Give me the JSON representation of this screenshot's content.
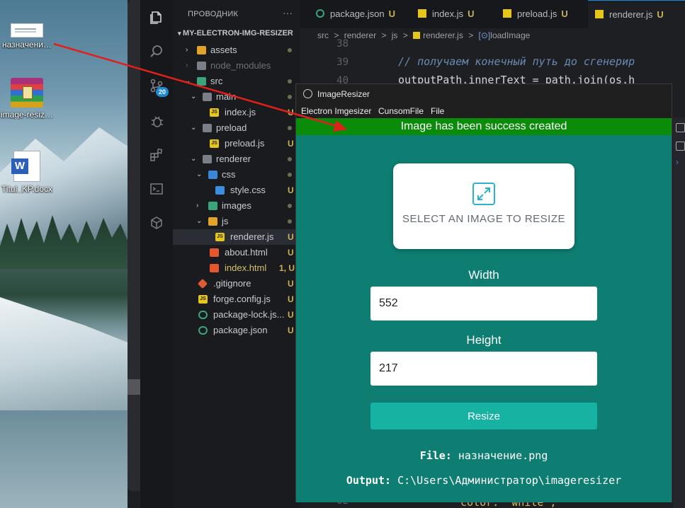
{
  "desktop": {
    "icons": [
      {
        "label": "назначени…"
      },
      {
        "label": "image-resiz…"
      },
      {
        "label": "Titul_KP.docx",
        "glyph": "W"
      }
    ]
  },
  "vscode": {
    "activity_badge": "20",
    "explorer": {
      "title": "ПРОВОДНИК",
      "more": "···",
      "root": "MY-ELECTRON-IMG-RESIZER",
      "items": [
        {
          "name": "assets",
          "status": ""
        },
        {
          "name": "node_modules",
          "status": ""
        },
        {
          "name": "src",
          "status": ""
        },
        {
          "name": "main",
          "status": ""
        },
        {
          "name": "index.js",
          "status": "U"
        },
        {
          "name": "preload",
          "status": ""
        },
        {
          "name": "preload.js",
          "status": "U"
        },
        {
          "name": "renderer",
          "status": ""
        },
        {
          "name": "css",
          "status": ""
        },
        {
          "name": "style.css",
          "status": "U"
        },
        {
          "name": "images",
          "status": ""
        },
        {
          "name": "js",
          "status": ""
        },
        {
          "name": "renderer.js",
          "status": "U"
        },
        {
          "name": "about.html",
          "status": "U"
        },
        {
          "name": "index.html",
          "status": "1, U"
        },
        {
          "name": ".gitignore",
          "status": "U"
        },
        {
          "name": "forge.config.js",
          "status": "U"
        },
        {
          "name": "package-lock.js...",
          "status": "U"
        },
        {
          "name": "package.json",
          "status": "U"
        }
      ]
    },
    "tabs": [
      {
        "label": "package.json",
        "status": "U"
      },
      {
        "label": "index.js",
        "status": "U"
      },
      {
        "label": "preload.js",
        "status": "U"
      },
      {
        "label": "renderer.js",
        "status": "U"
      }
    ],
    "breadcrumb": {
      "parts": [
        "src",
        "renderer",
        "js",
        "renderer.js",
        "loadImage"
      ],
      "sep": ">"
    },
    "code": {
      "line_numbers": [
        "38",
        "39",
        "40",
        "62"
      ],
      "comment": "// получаем конечный путь до сгенерир",
      "statement": "outputPath.innerText = path.join(os.h",
      "bottom": "color: 'white';"
    }
  },
  "app": {
    "window_title": "ImageResizer",
    "menu": [
      "Electron Imgesizer",
      "CunsomFile",
      "File"
    ],
    "alert": "Image has been success created",
    "dropzone_text": "SELECT AN IMAGE TO RESIZE",
    "width_label": "Width",
    "width_value": "552",
    "height_label": "Height",
    "height_value": "217",
    "resize_label": "Resize",
    "file_label": "File:",
    "file_value": "назначение.png",
    "output_label": "Output:",
    "output_value": "C:\\Users\\Администратор\\imageresizer"
  },
  "colors": {
    "app_background": "#0e7d72",
    "alert_background": "#0a8b0a",
    "button": "#16b3a3",
    "annotation_arrow": "#e0201a"
  }
}
